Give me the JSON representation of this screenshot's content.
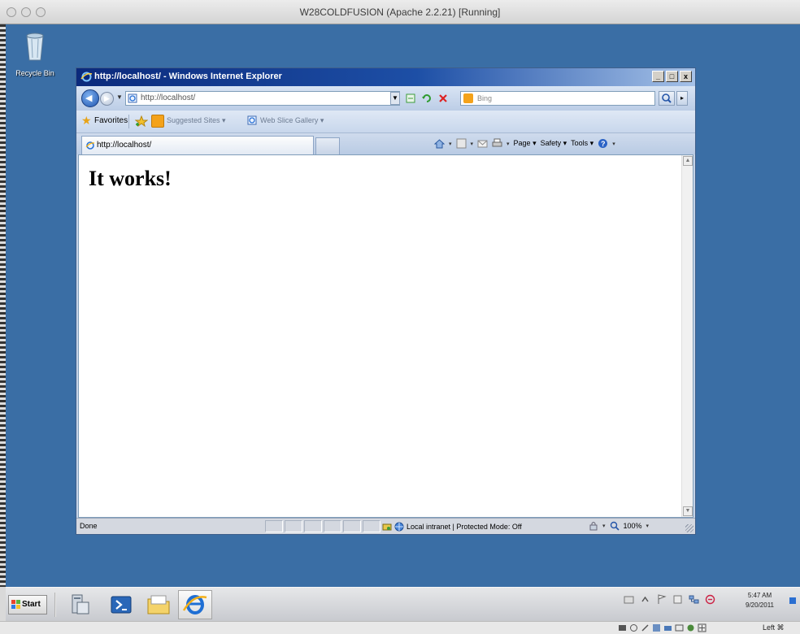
{
  "vm": {
    "window_title": "W28COLDFUSION (Apache 2.2.21) [Running]",
    "host_key": "Left ⌘"
  },
  "desktop": {
    "recycle_bin_label": "Recycle Bin"
  },
  "browser": {
    "title": "http://localhost/ - Windows Internet Explorer",
    "window_controls": [
      "_",
      "□",
      "x"
    ],
    "address": "http://localhost/",
    "search_placeholder": "Bing",
    "favorites_label": "Favorites",
    "suggested_sites_label": "Suggested Sites ▾",
    "web_slice_gallery_label": "Web Slice Gallery ▾",
    "tab_label": "http://localhost/",
    "command_bar": {
      "page_label": "Page",
      "safety_label": "Safety",
      "tools_label": "Tools"
    },
    "page_heading": "It works!",
    "status_text": "Done",
    "zone_text": "Local intranet | Protected Mode: Off",
    "zoom_level": "100%"
  },
  "taskbar": {
    "start_label": "Start",
    "clock_time": "5:47 AM",
    "clock_date": "9/20/2011"
  }
}
